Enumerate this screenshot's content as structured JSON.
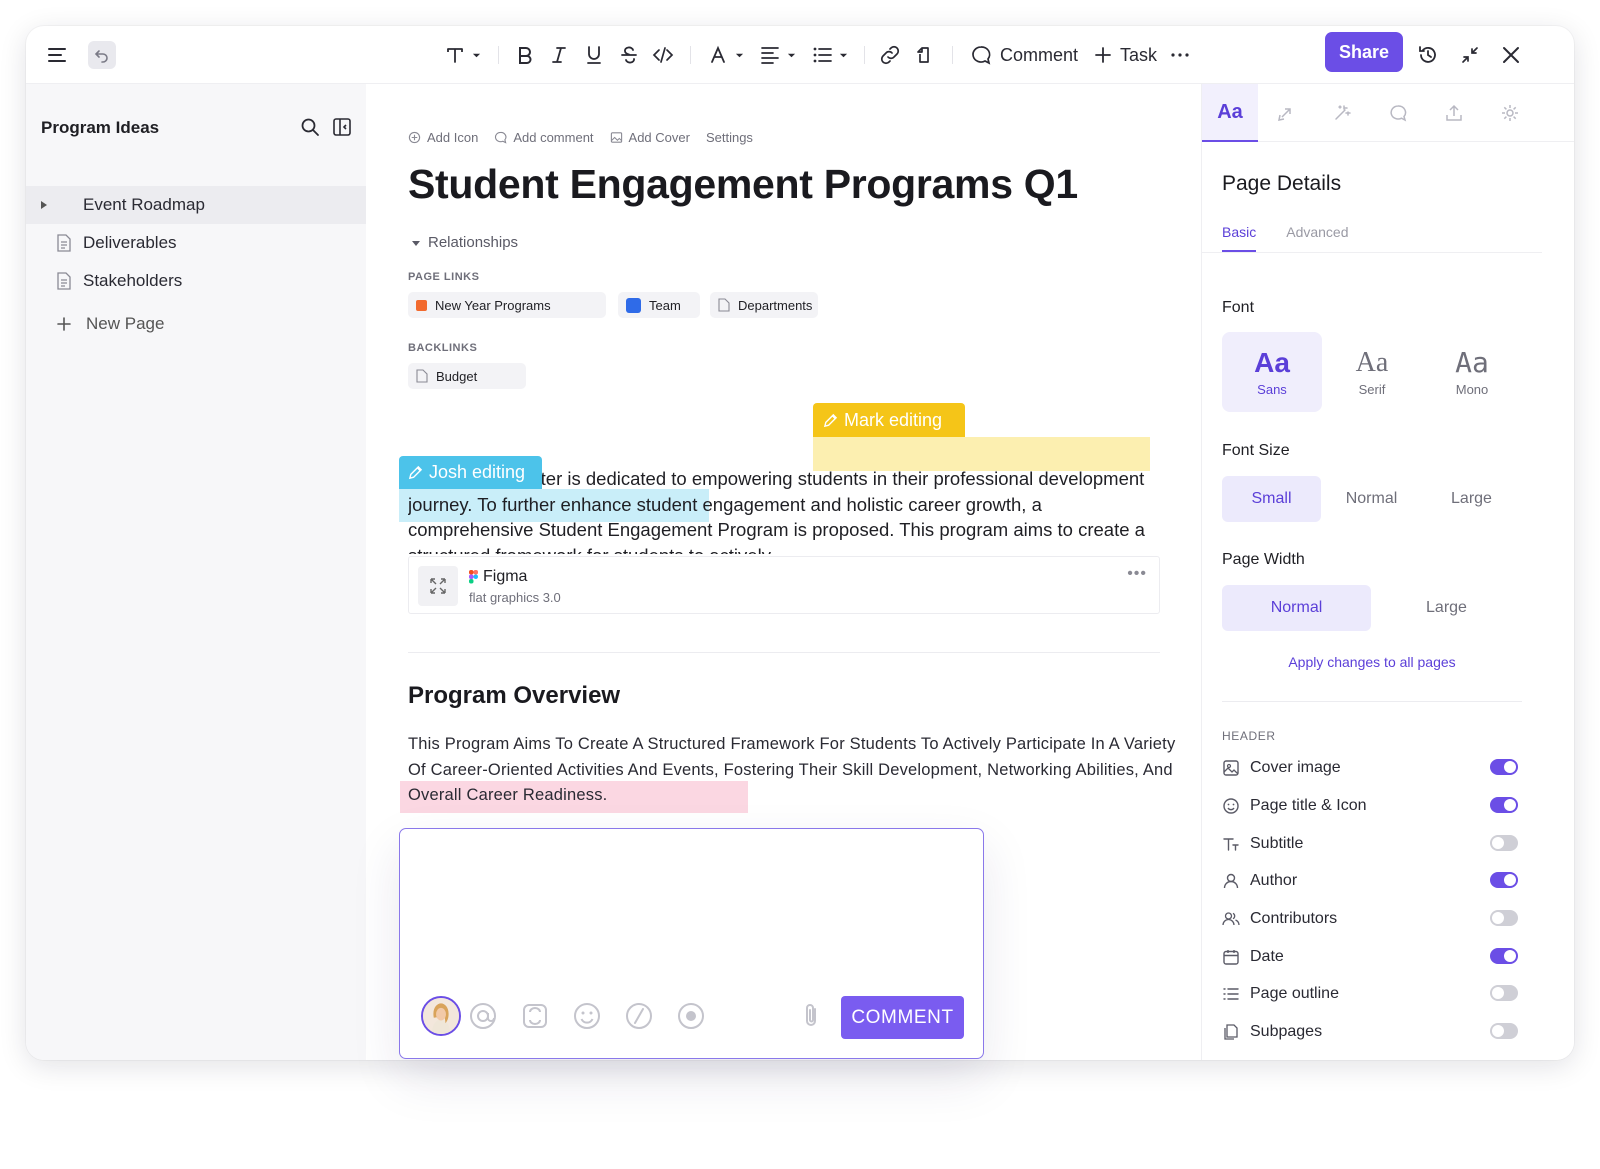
{
  "toolbar": {
    "comment_label": "Comment",
    "task_label": "Task",
    "share_label": "Share"
  },
  "sidebar": {
    "title": "Program Ideas",
    "items": [
      {
        "label": "Event Roadmap"
      },
      {
        "label": "Deliverables"
      },
      {
        "label": "Stakeholders"
      }
    ],
    "new_page_label": "New Page"
  },
  "doc": {
    "meta": [
      "Add Icon",
      "Add comment",
      "Add Cover",
      "Settings"
    ],
    "title": "Student Engagement Programs Q1",
    "relationships_label": "Relationships",
    "page_links_label": "PAGE LINKS",
    "page_links": [
      "New Year Programs",
      "Team",
      "Departments"
    ],
    "backlinks_label": "BACKLINKS",
    "backlinks": [
      "Budget"
    ],
    "mark_tag": "Mark editing",
    "josh_tag": "Josh editing",
    "para_line1": "The Career Center is dedicated to empowering students in their",
    "para_josh": "professional development journey.",
    "para_rest": " To further enhance student engagement and holistic career growth, a comprehensive Student Engagement Program is proposed. This program aims to create a structured framework for students to actively",
    "embed_name": "Figma",
    "embed_sub": "flat graphics 3.0",
    "embed_more": "•••",
    "h2": "Program Overview",
    "para2_a": "This Program Aims To Create A Structured Framework For Students To Actively Participate In A Variety Of Career-Oriented Activities And Events, Fostering Their Skill Development, ",
    "para2_b": "Networking Abilities, And Overall Career Rea",
    "para2_c": "diness."
  },
  "panel": {
    "active_tab": "Aa",
    "title": "Page Details",
    "subtabs": [
      "Basic",
      "Advanced"
    ],
    "font_label": "Font",
    "fonts": [
      {
        "glyph": "Aa",
        "name": "Sans"
      },
      {
        "glyph": "Aa",
        "name": "Serif"
      },
      {
        "glyph": "Aa",
        "name": "Mono"
      }
    ],
    "font_size_label": "Font Size",
    "font_sizes": [
      "Small",
      "Normal",
      "Large"
    ],
    "page_width_label": "Page Width",
    "page_widths": [
      "Normal",
      "Large"
    ],
    "apply_label": "Apply changes to all pages",
    "header_label": "HEADER",
    "toggles": [
      {
        "label": "Cover image",
        "on": true,
        "icon": "image-icon"
      },
      {
        "label": "Page title & Icon",
        "on": true,
        "icon": "smiley-icon"
      },
      {
        "label": "Subtitle",
        "on": false,
        "icon": "text-subtitle-icon"
      },
      {
        "label": "Author",
        "on": true,
        "icon": "user-icon"
      },
      {
        "label": "Contributors",
        "on": false,
        "icon": "users-icon"
      },
      {
        "label": "Date",
        "on": true,
        "icon": "calendar-icon"
      },
      {
        "label": "Page outline",
        "on": false,
        "icon": "outline-icon"
      },
      {
        "label": "Subpages",
        "on": false,
        "icon": "pages-icon"
      }
    ]
  },
  "comment_box": {
    "submit_label": "COMMENT"
  },
  "colors": {
    "accent": "#6b4ee6",
    "mark": "#f5c518",
    "josh": "#4cc3ea",
    "pink_highlight": "#fbd7e2"
  }
}
